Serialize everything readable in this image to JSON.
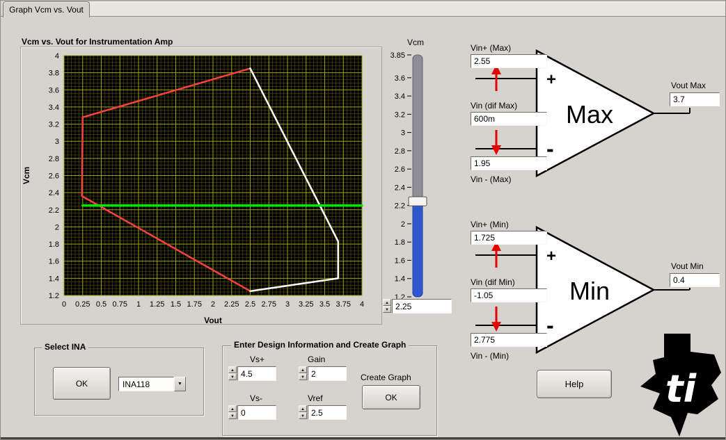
{
  "tab_label": "Graph Vcm vs. Vout",
  "icons": {
    "up_arrow": "▲",
    "down_arrow": "▼",
    "dropdown_arrow": "▼"
  },
  "chart_data": {
    "type": "line",
    "title": "Vcm vs. Vout for Instrumentation Amp",
    "xlabel": "Vout",
    "ylabel": "Vcm",
    "xlim": [
      0,
      4
    ],
    "ylim": [
      1.2,
      4
    ],
    "x_ticks": [
      "0",
      "0.25",
      "0.5",
      "0.75",
      "1",
      "1.25",
      "1.5",
      "1.75",
      "2",
      "2.25",
      "2.5",
      "2.75",
      "3",
      "3.25",
      "3.5",
      "3.75",
      "4"
    ],
    "y_ticks": [
      "4",
      "3.8",
      "3.6",
      "3.4",
      "3.2",
      "3",
      "2.8",
      "2.6",
      "2.4",
      "2.2",
      "2",
      "1.8",
      "1.6",
      "1.4",
      "1.2"
    ],
    "x_minor_step": 0.05,
    "y_minor_step": 0.04,
    "bg": "#000000",
    "grid_minor_color": "#565600",
    "grid_major_color": "#a0a000",
    "grid": true,
    "legend": false,
    "series": [
      {
        "name": "red-limit-boundary",
        "color": "#ff4242",
        "width": 2.5,
        "points": [
          [
            2.5,
            3.85
          ],
          [
            0.25,
            3.28
          ],
          [
            0.24,
            2.36
          ],
          [
            2.5,
            1.25
          ]
        ]
      },
      {
        "name": "white-limit-boundary",
        "color": "#ffffff",
        "width": 2.5,
        "points": [
          [
            2.5,
            3.85
          ],
          [
            3.68,
            1.83
          ],
          [
            3.68,
            1.4
          ],
          [
            2.5,
            1.25
          ]
        ]
      },
      {
        "name": "vcm-level-line",
        "color": "#00e600",
        "width": 3.5,
        "points": [
          [
            0.25,
            2.25
          ],
          [
            4,
            2.25
          ]
        ]
      }
    ]
  },
  "slider": {
    "label": "Vcm",
    "value": 2.25,
    "display_value": "2.25",
    "min": 1.2,
    "max": 3.85,
    "tick_values": [
      "3.85",
      "3.6",
      "3.4",
      "3.2",
      "3",
      "2.8",
      "2.6",
      "2.4",
      "2.2",
      "2",
      "1.8",
      "1.6",
      "1.4",
      "1.2"
    ],
    "fill_color": "#2e57d0",
    "track_color": "#8f8d98"
  },
  "max_amp": {
    "name": "Max",
    "plus": "+",
    "minus": "-",
    "vin_plus_label": "Vin+ (Max)",
    "vin_plus_value": "2.55",
    "vin_dif_label": "Vin (dif Max)",
    "vin_dif_value": "600m",
    "vin_minus_value": "1.95",
    "vin_minus_label": "Vin - (Max)",
    "vout_label": "Vout Max",
    "vout_value": "3.7"
  },
  "min_amp": {
    "name": "Min",
    "plus": "+",
    "minus": "-",
    "vin_plus_label": "Vin+ (Min)",
    "vin_plus_value": "1.725",
    "vin_dif_label": "Vin (dif Min)",
    "vin_dif_value": "-1.05",
    "vin_minus_value": "2.775",
    "vin_minus_label": "Vin - (Min)",
    "vout_label": "Vout Min",
    "vout_value": "0.4"
  },
  "select_ina": {
    "title": "Select INA",
    "ok_label": "OK",
    "ina_value": "INA118"
  },
  "design": {
    "title": "Enter Design Information and Create Graph",
    "vs_plus_label": "Vs+",
    "vs_plus_value": "4.5",
    "gain_label": "Gain",
    "gain_value": "2",
    "vs_minus_label": "Vs-",
    "vs_minus_value": "0",
    "vref_label": "Vref",
    "vref_value": "2.5",
    "create_graph_label": "Create Graph",
    "ok_label": "OK"
  },
  "help_label": "Help"
}
